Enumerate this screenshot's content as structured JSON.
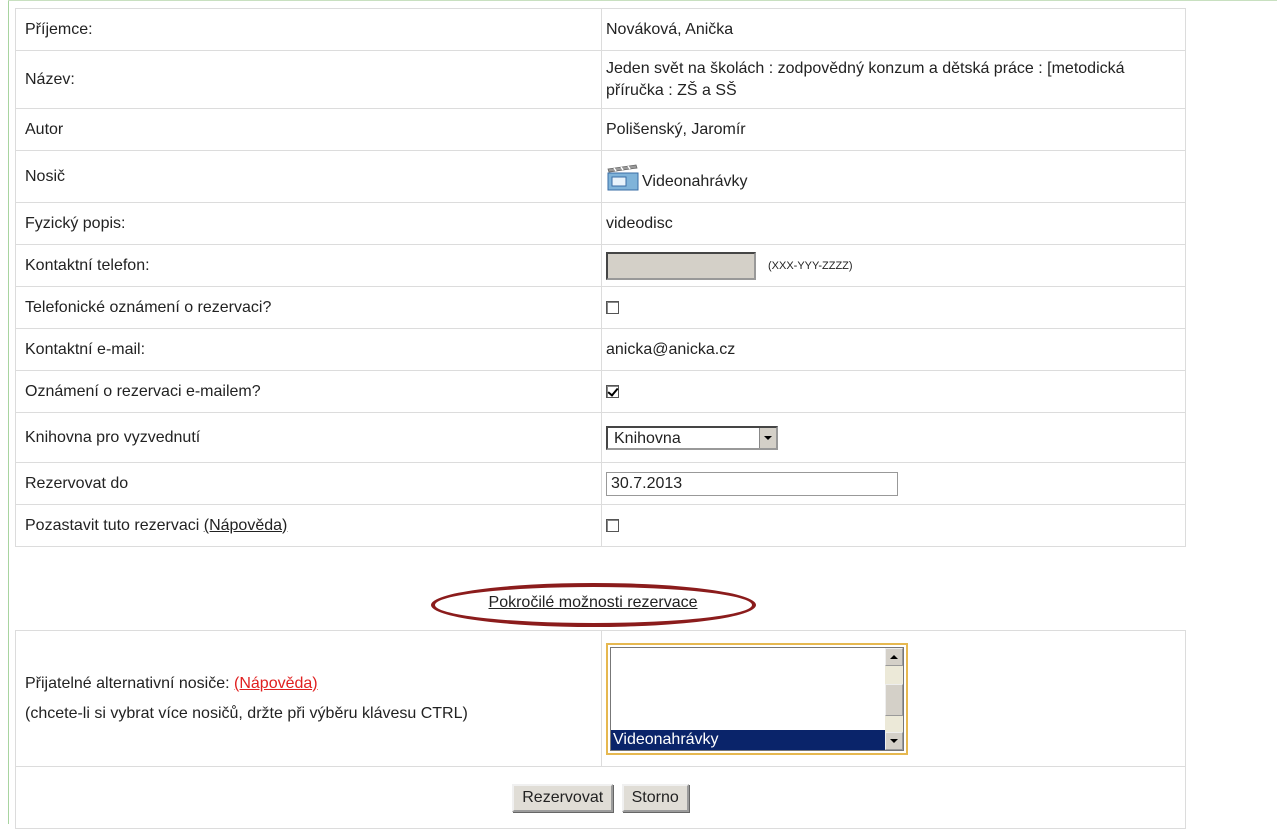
{
  "form": {
    "rows": [
      {
        "id": "recipient",
        "label": "Příjemce:",
        "value": "Nováková, Anička"
      },
      {
        "id": "title",
        "label": "Název:",
        "value": "Jeden svět na školách : zodpovědný konzum a dětská práce : [metodická příručka : ZŠ a SŠ"
      },
      {
        "id": "author",
        "label": "Autor",
        "value": "Polišenský, Jaromír"
      },
      {
        "id": "medium",
        "label": "Nosič",
        "value": "Videonahrávky",
        "icon": "video-icon"
      },
      {
        "id": "physical",
        "label": "Fyzický popis:",
        "value": "videodisc"
      },
      {
        "id": "phone",
        "label": "Kontaktní telefon:",
        "value": "",
        "hint": "(XXX-YYY-ZZZZ)"
      },
      {
        "id": "phone_notify",
        "label": "Telefonické oznámení o rezervaci?",
        "checked": false
      },
      {
        "id": "email",
        "label": "Kontaktní e-mail:",
        "value": "anicka@anicka.cz"
      },
      {
        "id": "email_notify",
        "label": "Oznámení o rezervaci e-mailem?",
        "checked": true
      },
      {
        "id": "pickup",
        "label": "Knihovna pro vyzvednutí",
        "selected": "Knihovna"
      },
      {
        "id": "reserve_until",
        "label": "Rezervovat do",
        "value": "30.7.2013"
      },
      {
        "id": "suspend",
        "label": "Pozastavit tuto rezervaci",
        "help": "(Nápověda)",
        "checked": false
      }
    ]
  },
  "advanced_link": "Pokročilé možnosti rezervace",
  "annotation_color": "#8b1c1c",
  "alternatives": {
    "label": "Přijatelné alternativní nosiče:",
    "help": "(Nápověda)",
    "note": "(chcete-li si vybrat více nosičů, držte při výběru klávesu CTRL)",
    "selected_option": "Videonahrávky"
  },
  "buttons": {
    "reserve": "Rezervovat",
    "cancel": "Storno"
  }
}
